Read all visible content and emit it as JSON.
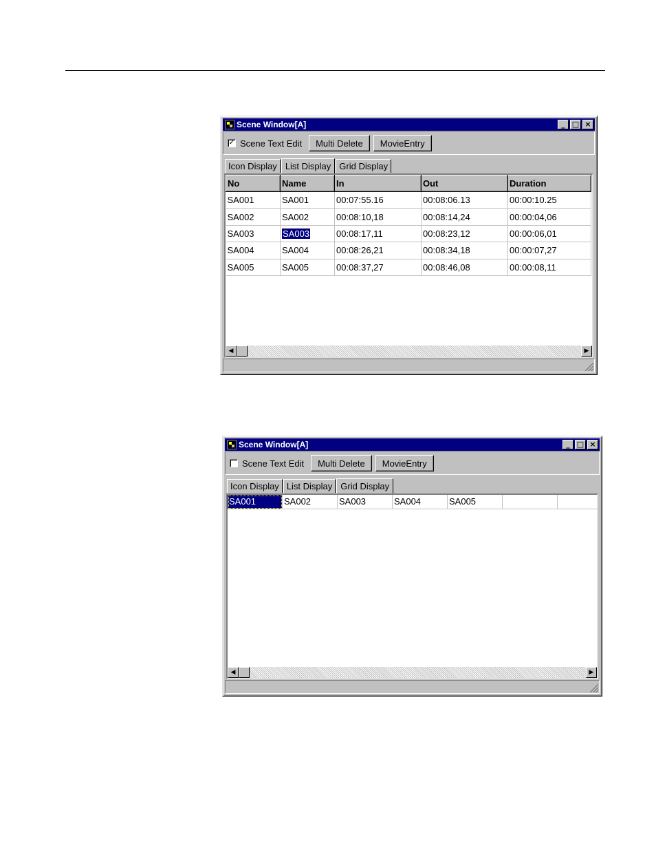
{
  "window1": {
    "title": "Scene Window[A]",
    "controls": {
      "minimize": "_",
      "maximize": "□",
      "close": "×"
    },
    "scene_text_edit": {
      "label": "Scene Text Edit",
      "checked": true,
      "mark": "✓"
    },
    "buttons": {
      "multi_delete": "Multi Delete",
      "movie_entry": "MovieEntry"
    },
    "tabs": [
      {
        "label": "Icon Display",
        "active": false
      },
      {
        "label": "List Display",
        "active": true
      },
      {
        "label": "Grid Display",
        "active": false
      }
    ],
    "columns": [
      "No",
      "Name",
      "In",
      "Out",
      "Duration"
    ],
    "rows": [
      {
        "no": "SA001",
        "name": "SA001",
        "in": "00:07:55.16",
        "out": "00:08:06.13",
        "duration": "00:00:10.25"
      },
      {
        "no": "SA002",
        "name": "SA002",
        "in": "00:08:10,18",
        "out": "00:08:14,24",
        "duration": "00:00:04,06"
      },
      {
        "no": "SA003",
        "name": "SA003",
        "in": "00:08:17,11",
        "out": "00:08:23,12",
        "duration": "00:00:06,01"
      },
      {
        "no": "SA004",
        "name": "SA004",
        "in": "00:08:26,21",
        "out": "00:08:34,18",
        "duration": "00:00:07,27"
      },
      {
        "no": "SA005",
        "name": "SA005",
        "in": "00:08:37,27",
        "out": "00:08:46,08",
        "duration": "00:00:08,11"
      }
    ],
    "selected_row": 2,
    "scroll": {
      "left": "◀",
      "right": "▶"
    }
  },
  "window2": {
    "title": "Scene Window[A]",
    "controls": {
      "minimize": "_",
      "maximize": "□",
      "close": "×"
    },
    "scene_text_edit": {
      "label": "Scene Text Edit",
      "checked": false,
      "mark": ""
    },
    "buttons": {
      "multi_delete": "Multi Delete",
      "movie_entry": "MovieEntry"
    },
    "tabs": [
      {
        "label": "Icon Display",
        "active": false
      },
      {
        "label": "List Display",
        "active": false
      },
      {
        "label": "Grid Display",
        "active": true
      }
    ],
    "grid_cells": [
      "SA001",
      "SA002",
      "SA003",
      "SA004",
      "SA005",
      "",
      ""
    ],
    "selected_cell": 0,
    "scroll": {
      "left": "◀",
      "right": "▶"
    }
  }
}
